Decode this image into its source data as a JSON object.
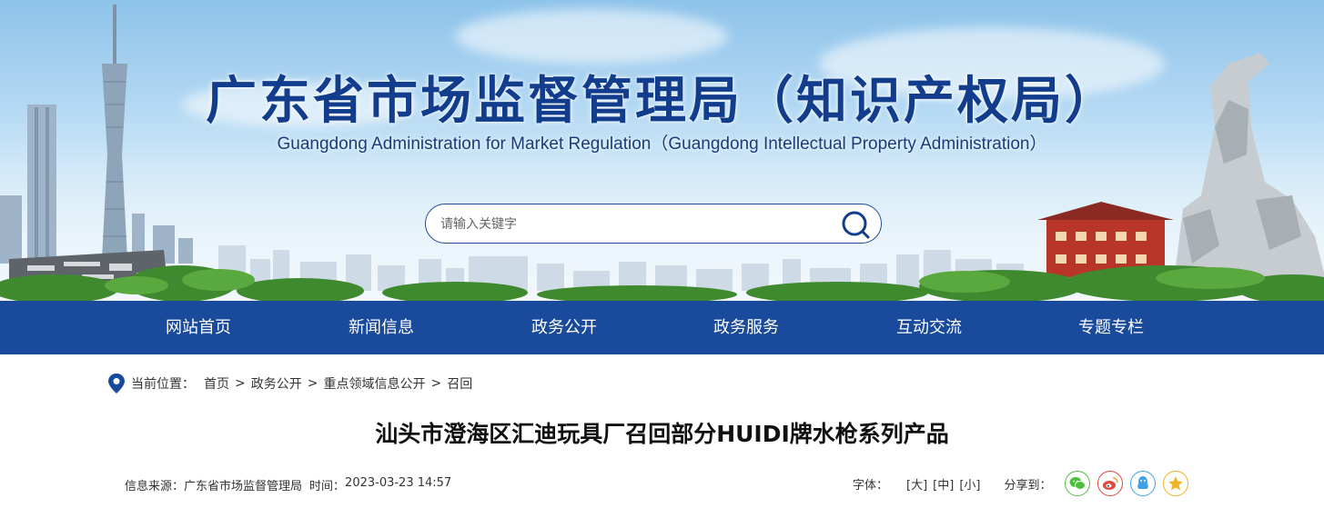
{
  "header": {
    "title": "广东省市场监督管理局（知识产权局）",
    "subtitle": "Guangdong Administration for Market Regulation（Guangdong Intellectual Property Administration）"
  },
  "search": {
    "placeholder": "请输入关键字"
  },
  "nav": {
    "items": [
      {
        "label": "网站首页"
      },
      {
        "label": "新闻信息"
      },
      {
        "label": "政务公开"
      },
      {
        "label": "政务服务"
      },
      {
        "label": "互动交流"
      },
      {
        "label": "专题专栏"
      }
    ]
  },
  "breadcrumb": {
    "label": "当前位置：",
    "items": [
      "首页",
      "政务公开",
      "重点领域信息公开",
      "召回"
    ],
    "separator": ">"
  },
  "article": {
    "title": "汕头市澄海区汇迪玩具厂召回部分HUIDI牌水枪系列产品",
    "source_label": "信息来源：",
    "source": "广东省市场监督管理局",
    "time_label": "时间：",
    "time": "2023-03-23 14:57",
    "font_label": "字体：",
    "font_sizes": [
      "[大]",
      "[中]",
      "[小]"
    ],
    "share_label": "分享到："
  },
  "colors": {
    "nav_bg": "#1a4a9c",
    "title_blue": "#123c8c",
    "wechat": "#4cbf3c",
    "weibo": "#e2483f",
    "qq": "#3fa0e6",
    "qzone": "#f0b323"
  },
  "icons": {
    "search": "search-icon",
    "location": "location-pin-icon",
    "share": [
      "wechat-icon",
      "weibo-icon",
      "qq-icon",
      "qzone-icon"
    ]
  }
}
